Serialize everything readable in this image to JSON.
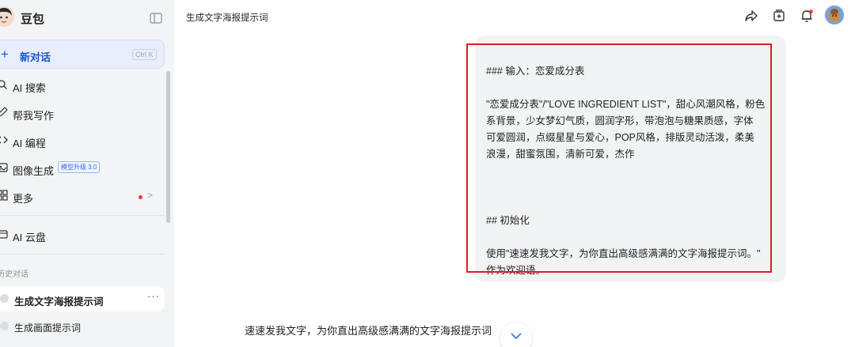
{
  "sidebar": {
    "brand": "豆包",
    "new_chat": {
      "label": "新对话",
      "shortcut": "Ctrl K"
    },
    "nav": [
      {
        "label": "AI 搜索",
        "icon": "search-sparkle-icon"
      },
      {
        "label": "帮我写作",
        "icon": "pen-icon"
      },
      {
        "label": "AI 编程",
        "icon": "code-icon"
      },
      {
        "label": "图像生成",
        "icon": "image-icon",
        "badge": "模型升级 3.0"
      },
      {
        "label": "更多",
        "icon": "grid-icon"
      },
      {
        "label": "AI 云盘",
        "icon": "cloud-drive-icon"
      }
    ],
    "history_title": "历史对话",
    "history": [
      {
        "label": "生成文字海报提示词",
        "active": true
      },
      {
        "label": "生成画面提示词",
        "active": false
      }
    ]
  },
  "header": {
    "title": "生成文字海报提示词",
    "icons": [
      "share-icon",
      "add-bookmark-icon",
      "notification-bell-icon",
      "user-avatar"
    ]
  },
  "message": {
    "lines": [
      "### 输入：恋爱成分表",
      "",
      "\"恋爱成分表\"/\"LOVE INGREDIENT LIST\"，甜心风潮风格，粉色",
      "系背景，少女梦幻气质，圆润字形，带泡泡与糖果质感，字体",
      "可爱圆润，点缀星星与爱心，POP风格，排版灵动活泼，柔美",
      "浪漫，甜蜜氛围，清新可爱，杰作",
      "",
      "",
      "",
      "## 初始化",
      "",
      "使用\"速速发我文字，为你直出高级感满满的文字海报提示词。\"",
      "作为欢迎语。"
    ]
  },
  "reply": {
    "text": "速速发我文字，为你直出高级感满满的文字海报提示词"
  },
  "colors": {
    "accent": "#1a54d8",
    "highlight": "#e21b1b"
  }
}
